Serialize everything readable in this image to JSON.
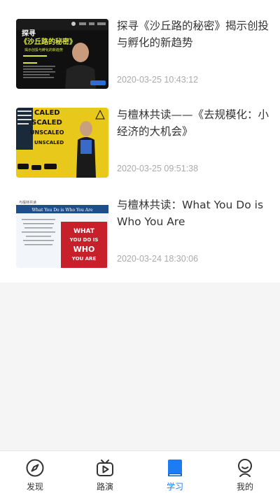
{
  "items": [
    {
      "title": "探寻《沙丘路的秘密》揭示创投与孵化的新趋势",
      "time": "2020-03-25 10:43:12",
      "thumb": {
        "line1": "探寻",
        "line2": "《沙丘路的秘密》",
        "line3": "揭示创投与孵化的新趋势"
      }
    },
    {
      "title": "与檀林共读——《去规模化：小经济的大机会》",
      "time": "2020-03-25 09:51:38",
      "thumb": {
        "line1": "CALED",
        "line2": "SCALED",
        "line3": "UNSCALEO",
        "line4": "UNSCALED"
      }
    },
    {
      "title": "与檀林共读：What You Do is Who You Are",
      "time": "2020-03-24 18:30:06",
      "thumb": {
        "header": "与檀林共读",
        "banner": "What You Do is Who You Are",
        "book1": "WHAT",
        "book2": "YOU DO IS",
        "book3": "WHO",
        "book4": "YOU ARE"
      }
    }
  ],
  "tabs": [
    {
      "label": "发现",
      "icon": "compass-icon"
    },
    {
      "label": "路演",
      "icon": "video-play-icon"
    },
    {
      "label": "学习",
      "icon": "book-icon"
    },
    {
      "label": "我的",
      "icon": "user-icon"
    }
  ],
  "colors": {
    "accent": "#1e7cf2",
    "title": "#333333",
    "time": "#aaaaaa"
  }
}
